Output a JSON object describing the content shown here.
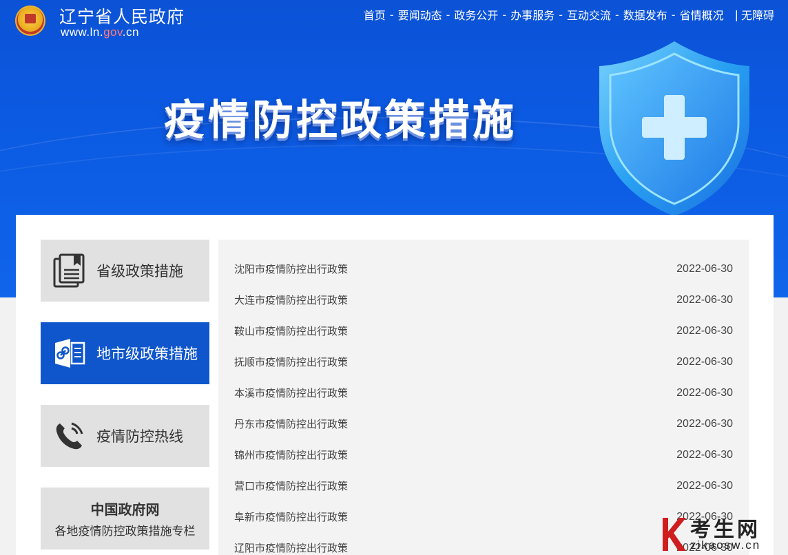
{
  "header": {
    "site_name": "辽宁省人民政府",
    "url_prefix": "www.ln.",
    "url_gov": "gov",
    "url_suffix": ".cn",
    "nav": [
      "首页",
      "要闻动态",
      "政务公开",
      "办事服务",
      "互动交流",
      "数据发布",
      "省情概况"
    ],
    "nav_separator": "-",
    "accessibility": "无障碍"
  },
  "banner": {
    "title": "疫情防控政策措施"
  },
  "sidebar": {
    "items": [
      {
        "label": "省级政策措施",
        "icon": "document-bookmark-icon",
        "active": false
      },
      {
        "label": "地市级政策措施",
        "icon": "link-document-icon",
        "active": true
      },
      {
        "label": "疫情防控热线",
        "icon": "phone-icon",
        "active": false
      }
    ],
    "china_gov": {
      "line1": "中国政府网",
      "line2": "各地疫情防控政策措施专栏"
    }
  },
  "list": {
    "rows": [
      {
        "title": "沈阳市疫情防控出行政策",
        "date": "2022-06-30"
      },
      {
        "title": "大连市疫情防控出行政策",
        "date": "2022-06-30"
      },
      {
        "title": "鞍山市疫情防控出行政策",
        "date": "2022-06-30"
      },
      {
        "title": "抚顺市疫情防控出行政策",
        "date": "2022-06-30"
      },
      {
        "title": "本溪市疫情防控出行政策",
        "date": "2022-06-30"
      },
      {
        "title": "丹东市疫情防控出行政策",
        "date": "2022-06-30"
      },
      {
        "title": "锦州市疫情防控出行政策",
        "date": "2022-06-30"
      },
      {
        "title": "营口市疫情防控出行政策",
        "date": "2022-06-30"
      },
      {
        "title": "阜新市疫情防控出行政策",
        "date": "2022-06-30"
      },
      {
        "title": "辽阳市疫情防控出行政策",
        "date": "2022-06-30"
      }
    ]
  },
  "watermark": {
    "big": "考生网",
    "small": "zikaosw.cn"
  },
  "colors": {
    "brand_blue": "#0f56cc",
    "banner_blue": "#0c5ae2"
  }
}
